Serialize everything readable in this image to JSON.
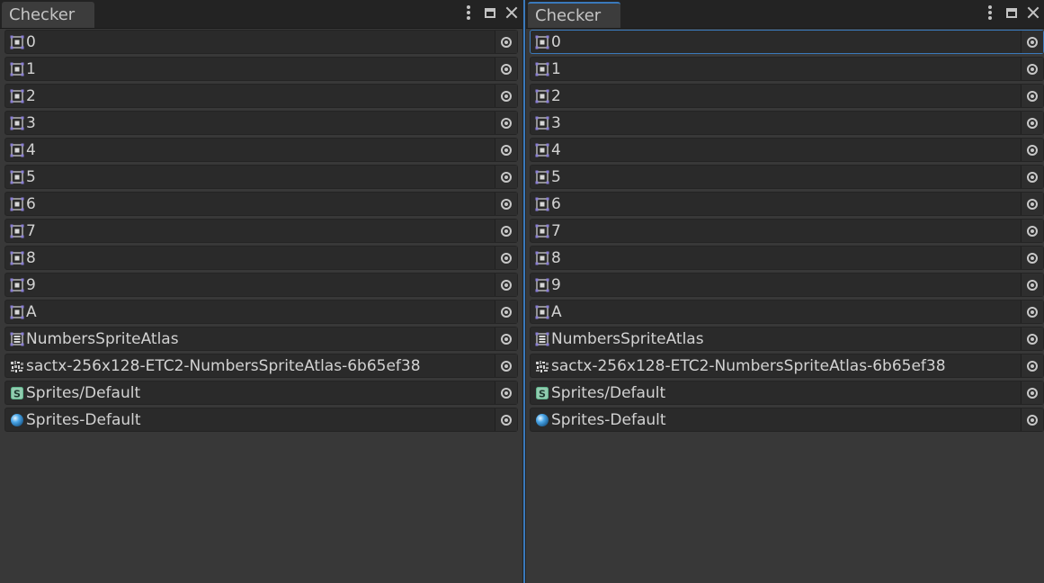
{
  "left_panel": {
    "tab_title": "Checker",
    "items": [
      {
        "label": "0",
        "icon": "sprite-icon"
      },
      {
        "label": "1",
        "icon": "sprite-icon"
      },
      {
        "label": "2",
        "icon": "sprite-icon"
      },
      {
        "label": "3",
        "icon": "sprite-icon"
      },
      {
        "label": "4",
        "icon": "sprite-icon"
      },
      {
        "label": "5",
        "icon": "sprite-icon"
      },
      {
        "label": "6",
        "icon": "sprite-icon"
      },
      {
        "label": "7",
        "icon": "sprite-icon"
      },
      {
        "label": "8",
        "icon": "sprite-icon"
      },
      {
        "label": "9",
        "icon": "sprite-icon"
      },
      {
        "label": "A",
        "icon": "sprite-icon"
      },
      {
        "label": "NumbersSpriteAtlas",
        "icon": "sprite-atlas-icon"
      },
      {
        "label": "sactx-256x128-ETC2-NumbersSpriteAtlas-6b65ef38",
        "icon": "texture-icon"
      },
      {
        "label": "Sprites/Default",
        "icon": "shader-icon"
      },
      {
        "label": "Sprites-Default",
        "icon": "material-icon"
      }
    ]
  },
  "right_panel": {
    "tab_title": "Checker",
    "items": [
      {
        "label": "0",
        "icon": "sprite-icon"
      },
      {
        "label": "1",
        "icon": "sprite-icon"
      },
      {
        "label": "2",
        "icon": "sprite-icon"
      },
      {
        "label": "3",
        "icon": "sprite-icon"
      },
      {
        "label": "4",
        "icon": "sprite-icon"
      },
      {
        "label": "5",
        "icon": "sprite-icon"
      },
      {
        "label": "6",
        "icon": "sprite-icon"
      },
      {
        "label": "7",
        "icon": "sprite-icon"
      },
      {
        "label": "8",
        "icon": "sprite-icon"
      },
      {
        "label": "9",
        "icon": "sprite-icon"
      },
      {
        "label": "A",
        "icon": "sprite-icon"
      },
      {
        "label": "NumbersSpriteAtlas",
        "icon": "sprite-atlas-icon"
      },
      {
        "label": "sactx-256x128-ETC2-NumbersSpriteAtlas-6b65ef38",
        "icon": "texture-icon"
      },
      {
        "label": "Sprites/Default",
        "icon": "shader-icon"
      },
      {
        "label": "Sprites-Default",
        "icon": "material-icon"
      }
    ]
  },
  "colors": {
    "background": "#383838",
    "field": "#2a2a2a",
    "focus_accent": "#3a79bb",
    "text": "#d2d2d2",
    "sprite_icon": "#8a7fd6",
    "shader_icon": "#5fb58c",
    "material_icon": "#4aa6e8"
  }
}
